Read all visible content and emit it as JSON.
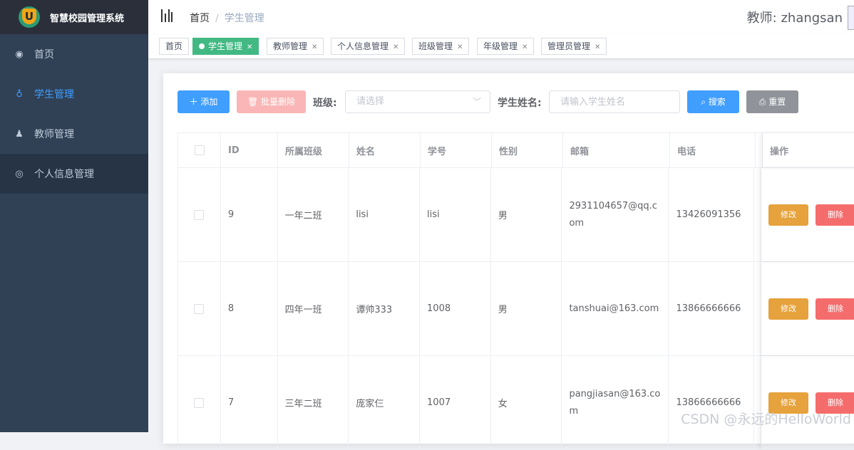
{
  "app": {
    "title": "智慧校园管理系统",
    "logo_letter": "U"
  },
  "sidebar": {
    "items": [
      {
        "label": "首页",
        "icon": "dashboard-icon",
        "glyph": "◉"
      },
      {
        "label": "学生管理",
        "icon": "user-icon",
        "glyph": "♁"
      },
      {
        "label": "教师管理",
        "icon": "peoples-icon",
        "glyph": "♟"
      },
      {
        "label": "个人信息管理",
        "icon": "profile-icon",
        "glyph": "◎"
      }
    ]
  },
  "header": {
    "breadcrumb_home": "首页",
    "breadcrumb_sep": "/",
    "breadcrumb_current": "学生管理",
    "user": "教师: zhangsan"
  },
  "tags": [
    {
      "label": "首页"
    },
    {
      "label": "学生管理"
    },
    {
      "label": "教师管理"
    },
    {
      "label": "个人信息管理"
    },
    {
      "label": "班级管理"
    },
    {
      "label": "年级管理"
    },
    {
      "label": "管理员管理"
    }
  ],
  "toolbar": {
    "add": "＋ 添加",
    "batch_delete": "🗑 批量删除",
    "class_label": "班级:",
    "class_placeholder": "请选择",
    "name_label": "学生姓名:",
    "name_placeholder": "请输入学生姓名",
    "search": "⌕ 搜索",
    "reset": "⎙ 重置"
  },
  "table": {
    "columns": [
      "ID",
      "所属班级",
      "姓名",
      "学号",
      "性别",
      "邮箱",
      "电话",
      "操作"
    ],
    "rows": [
      {
        "id": "9",
        "class": "一年二班",
        "name": "lisi",
        "sno": "lisi",
        "gender": "男",
        "email": "2931104657@qq.com",
        "phone": "13426091356"
      },
      {
        "id": "8",
        "class": "四年一班",
        "name": "谭帅333",
        "sno": "1008",
        "gender": "男",
        "email": "tanshuai@163.com",
        "phone": "13866666666"
      },
      {
        "id": "7",
        "class": "三年二班",
        "name": "庞家仨",
        "sno": "1007",
        "gender": "女",
        "email": "pangjiasan@163.com",
        "phone": "13866666666"
      }
    ],
    "edit_label": "修改",
    "delete_label": "删除"
  },
  "watermark": "CSDN @永远的HelloWorld",
  "colors": {
    "sidebar": "#304156",
    "primary": "#409eff",
    "tag_active": "#42b983",
    "warning": "#e6a23c",
    "danger": "#f56c6c"
  }
}
